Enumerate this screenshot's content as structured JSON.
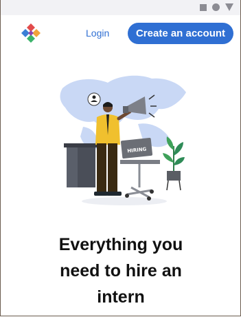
{
  "header": {
    "login_label": "Login",
    "cta_label": "Create an account"
  },
  "hero": {
    "illustration_text": "HIRING",
    "headline_lines": [
      "Everything you",
      "need to hire an",
      "intern"
    ]
  },
  "colors": {
    "accent": "#2f6fd3",
    "status_gray": "#8c8c93",
    "map_blue": "#c9d8f5"
  },
  "icons": [
    "logo-icon",
    "megaphone-icon",
    "plant-icon",
    "user-icon"
  ]
}
